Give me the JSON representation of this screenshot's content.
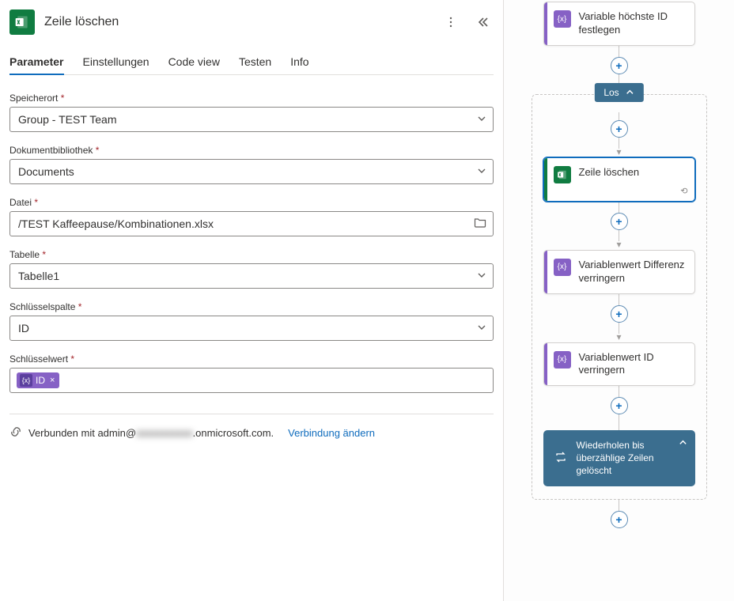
{
  "header": {
    "title": "Zeile löschen"
  },
  "tabs": {
    "parameter": "Parameter",
    "settings": "Einstellungen",
    "code": "Code view",
    "test": "Testen",
    "info": "Info"
  },
  "form": {
    "location_label": "Speicherort",
    "location_value": "Group - TEST Team",
    "library_label": "Dokumentbibliothek",
    "library_value": "Documents",
    "file_label": "Datei",
    "file_value": "/TEST Kaffeepause/Kombinationen.xlsx",
    "table_label": "Tabelle",
    "table_value": "Tabelle1",
    "keycol_label": "Schlüsselspalte",
    "keycol_value": "ID",
    "keyval_label": "Schlüsselwert",
    "keyval_token": "ID"
  },
  "connection": {
    "prefix": "Verbunden mit admin@",
    "blurred": "xxxxxxxxxxx",
    "suffix": ".onmicrosoft.com.",
    "change": "Verbindung ändern"
  },
  "flow": {
    "step_var_highest": "Variable höchste ID festlegen",
    "loop_label": "Los",
    "step_delete_row": "Zeile löschen",
    "step_var_diff": "Variablenwert Differenz verringern",
    "step_var_id": "Variablenwert ID verringern",
    "loop_footer": "Wiederholen bis überzählige Zeilen gelöscht"
  }
}
